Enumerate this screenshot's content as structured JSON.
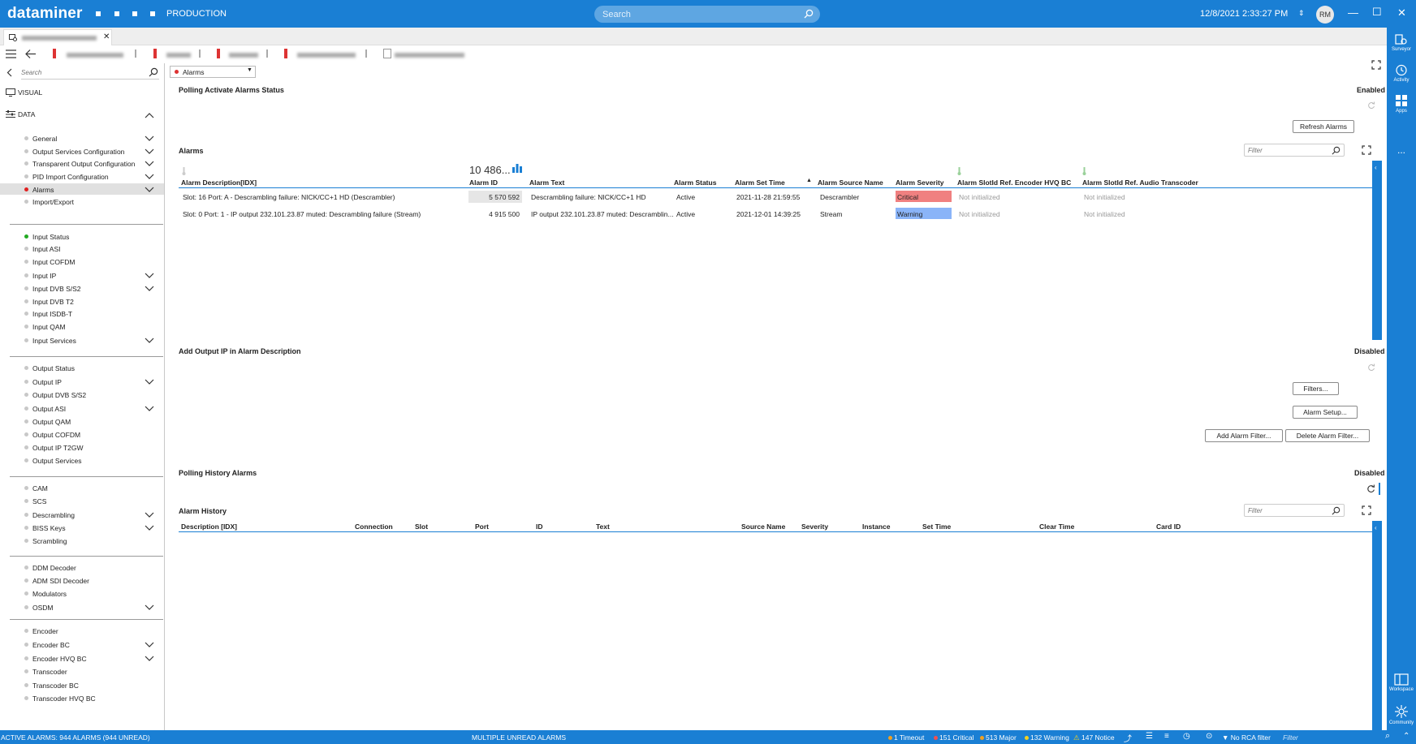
{
  "header": {
    "logo": "dataminer",
    "environment": "PRODUCTION",
    "search_placeholder": "Search",
    "datetime": "12/8/2021 2:33:27 PM",
    "user_initials": "RM",
    "accent": "#1a7fd4"
  },
  "rail": {
    "items": [
      {
        "label": "Surveyor",
        "icon": "surveyor-icon"
      },
      {
        "label": "Activity",
        "icon": "activity-icon"
      },
      {
        "label": "Apps",
        "icon": "apps-icon"
      },
      {
        "label": "...",
        "icon": "more-icon"
      },
      {
        "label": "Workspace",
        "icon": "workspace-icon"
      },
      {
        "label": "Community",
        "icon": "community-icon"
      }
    ]
  },
  "left_panel": {
    "search_placeholder": "Search",
    "visual_label": "VISUAL",
    "data_label": "DATA",
    "items": [
      "General",
      "Output Services Configuration",
      "Transparent Output Configuration",
      "PID Import Configuration",
      "Alarms",
      "Import/Export",
      "Input Status",
      "Input ASI",
      "Input COFDM",
      "Input IP",
      "Input DVB S/S2",
      "Input DVB T2",
      "Input ISDB-T",
      "Input QAM",
      "Input Services",
      "Output Status",
      "Output IP",
      "Output DVB S/S2",
      "Output ASI",
      "Output QAM",
      "Output COFDM",
      "Output IP T2GW",
      "Output Services",
      "CAM",
      "SCS",
      "Descrambling",
      "BISS Keys",
      "Scrambling",
      "DDM Decoder",
      "ADM SDI Decoder",
      "Modulators",
      "OSDM",
      "Encoder",
      "Encoder BC",
      "Encoder HVQ BC",
      "Transcoder",
      "Transcoder BC",
      "Transcoder HVQ BC"
    ]
  },
  "main": {
    "page_dropdown": "Alarms",
    "polling_active": {
      "title": "Polling Activate Alarms Status",
      "status": "Enabled"
    },
    "refresh_button": "Refresh Alarms",
    "alarms_title": "Alarms",
    "filter_placeholder": "Filter",
    "alarm_count": "10 486...",
    "alarms_columns": [
      "Alarm Description[IDX]",
      "Alarm ID",
      "Alarm Text",
      "Alarm Status",
      "Alarm Set Time",
      "Alarm Source Name",
      "Alarm Severity",
      "Alarm SlotId Ref. Encoder HVQ BC",
      "Alarm SlotId Ref. Audio Transcoder"
    ],
    "alarms_rows": [
      [
        "Slot: 16 Port: A - Descrambling failure: NICK/CC+1 HD (Descrambler)",
        "5 570 592",
        "Descrambling failure: NICK/CC+1 HD",
        "Active",
        "2021-11-28 21:59:55",
        "Descrambler",
        "Critical",
        "Not initialized",
        "Not initialized"
      ],
      [
        "Slot: 0 Port: 1 - IP output 232.101.23.87 muted: Descrambling failure (Stream)",
        "4 915 500",
        "IP output 232.101.23.87 muted: Descramblin...",
        "Active",
        "2021-12-01 14:39:25",
        "Stream",
        "Warning",
        "Not initialized",
        "Not initialized"
      ]
    ],
    "severity_colors": {
      "Critical": "#f08080",
      "Warning": "#8ab4f8"
    },
    "add_output_ip": {
      "title": "Add Output IP in Alarm Description",
      "status": "Disabled"
    },
    "filters_button": "Filters...",
    "alarm_setup_button": "Alarm Setup...",
    "add_filter_button": "Add Alarm Filter...",
    "delete_filter_button": "Delete Alarm Filter...",
    "polling_history": {
      "title": "Polling History Alarms",
      "status": "Disabled"
    },
    "history_title": "Alarm History",
    "history_columns": [
      "Description [IDX]",
      "Connection",
      "Slot",
      "Port",
      "ID",
      "Text",
      "Source Name",
      "Severity",
      "Instance",
      "Set Time",
      "Clear Time",
      "Card ID"
    ]
  },
  "statusbar": {
    "active_alarms": "ACTIVE ALARMS: 944 ALARMS (944 UNREAD)",
    "center": "MULTIPLE UNREAD ALARMS",
    "timeout": "1 Timeout",
    "critical": "151 Critical",
    "major": "513 Major",
    "warning": "132 Warning",
    "notice": "147 Notice",
    "rca_filter": "No RCA filter",
    "filter_placeholder": "Filter"
  }
}
